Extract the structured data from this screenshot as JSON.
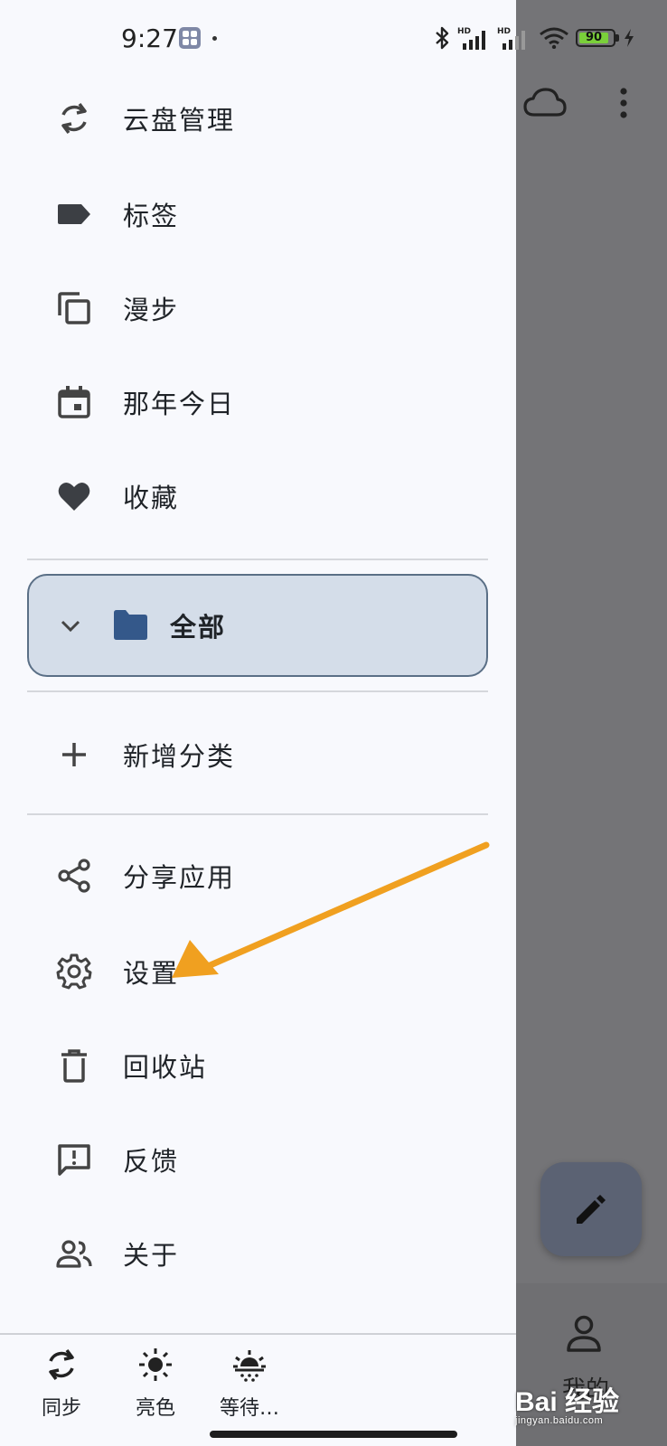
{
  "status_bar": {
    "time": "9:27",
    "battery": "90",
    "network_badge": "HD",
    "accent_battery": "#7ad03a"
  },
  "menu": {
    "top_items": [
      {
        "label": "云盘管理",
        "icon": "sync-icon"
      },
      {
        "label": "标签",
        "icon": "label-icon"
      },
      {
        "label": "漫步",
        "icon": "copy-icon"
      },
      {
        "label": "那年今日",
        "icon": "calendar-icon"
      },
      {
        "label": "收藏",
        "icon": "heart-icon"
      }
    ],
    "category": {
      "label": "全部",
      "icon": "folder-icon",
      "selected": true
    },
    "add_category": {
      "label": "新增分类",
      "icon": "plus-icon"
    },
    "bottom_items": [
      {
        "label": "分享应用",
        "icon": "share-icon"
      },
      {
        "label": "设置",
        "icon": "gear-icon"
      },
      {
        "label": "回收站",
        "icon": "trash-icon"
      },
      {
        "label": "反馈",
        "icon": "feedback-icon"
      },
      {
        "label": "关于",
        "icon": "people-icon"
      }
    ]
  },
  "bottom_bar": {
    "sync": "同步",
    "light": "亮色",
    "waiting": "等待…"
  },
  "scrim": {
    "mine_label": "我的",
    "watermark": "Bai 经验",
    "watermark_url": "jingyan.baidu.com"
  },
  "colors": {
    "drawer_bg": "#f8f9fd",
    "selected_bg": "#d4dde9",
    "selected_border": "#5a6f86",
    "folder": "#34588a",
    "arrow": "#f0a020",
    "scrim": "#747477"
  }
}
